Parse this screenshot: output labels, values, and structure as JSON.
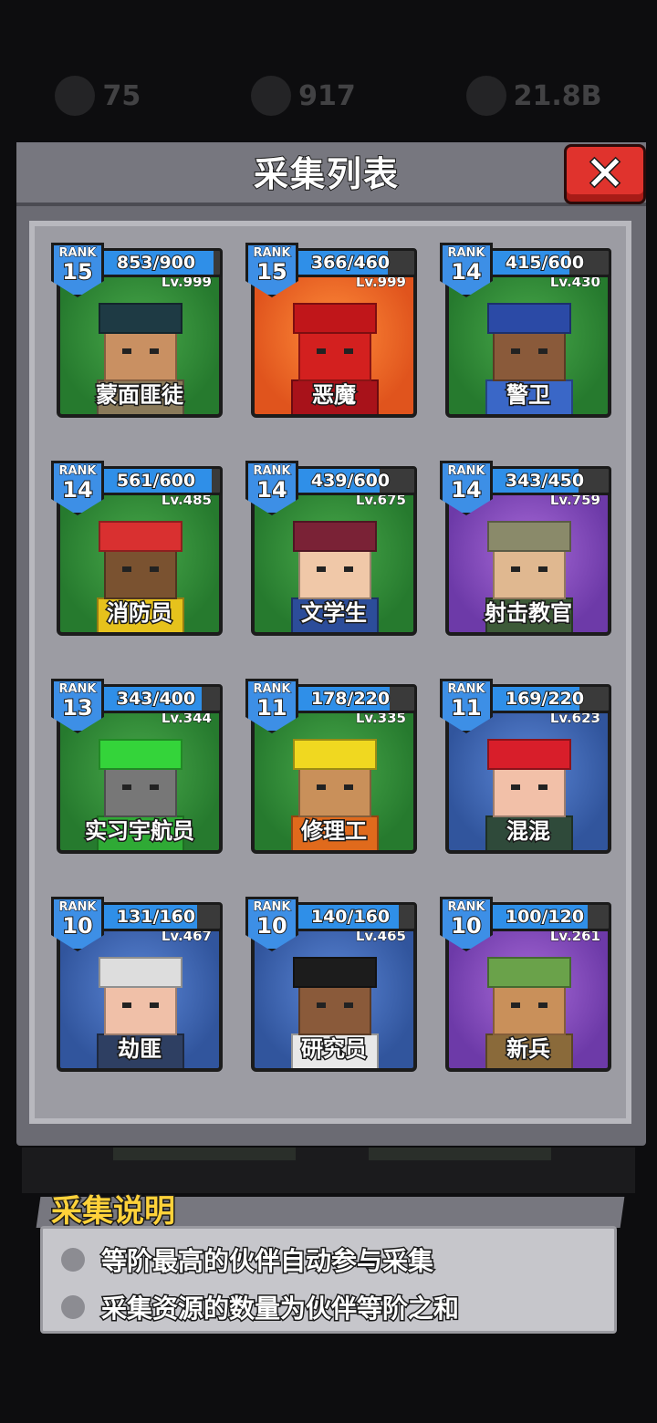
{
  "top_resources": [
    {
      "icon": "resource-icon",
      "value": "75"
    },
    {
      "icon": "resource-icon",
      "value": "917"
    },
    {
      "icon": "resource-icon",
      "value": "21.8B"
    }
  ],
  "dialog": {
    "title": "采集列表",
    "close_label": "✕"
  },
  "rank_label": "RANK",
  "companions": [
    {
      "rank": "15",
      "progress": "853/900",
      "progress_fraction": 0.948,
      "level": "Lv.999",
      "name": "蒙面匪徒",
      "bg": "green",
      "hat": "#1e3a44",
      "skin": "#c99062",
      "outfit": "#8a7a5a"
    },
    {
      "rank": "15",
      "progress": "366/460",
      "progress_fraction": 0.796,
      "level": "Lv.999",
      "name": "恶魔",
      "bg": "orange",
      "hat": "#c0161a",
      "skin": "#d3201f",
      "outfit": "#a8121a"
    },
    {
      "rank": "14",
      "progress": "415/600",
      "progress_fraction": 0.692,
      "level": "Lv.430",
      "name": "警卫",
      "bg": "green",
      "hat": "#2b4aa6",
      "skin": "#8a5a3a",
      "outfit": "#3a67c7"
    },
    {
      "rank": "14",
      "progress": "561/600",
      "progress_fraction": 0.935,
      "level": "Lv.485",
      "name": "消防员",
      "bg": "green",
      "hat": "#d93030",
      "skin": "#7a5230",
      "outfit": "#e6c21c"
    },
    {
      "rank": "14",
      "progress": "439/600",
      "progress_fraction": 0.732,
      "level": "Lv.675",
      "name": "文学生",
      "bg": "green",
      "hat": "#7a2236",
      "skin": "#f0c8a8",
      "outfit": "#2c4d9a"
    },
    {
      "rank": "14",
      "progress": "343/450",
      "progress_fraction": 0.762,
      "level": "Lv.759",
      "name": "射击教官",
      "bg": "purple",
      "hat": "#8a8a6a",
      "skin": "#e0b890",
      "outfit": "#3d5a38"
    },
    {
      "rank": "13",
      "progress": "343/400",
      "progress_fraction": 0.858,
      "level": "Lv.344",
      "name": "实习宇航员",
      "bg": "green",
      "hat": "#34d43a",
      "skin": "#777777",
      "outfit": "#2faa35"
    },
    {
      "rank": "11",
      "progress": "178/220",
      "progress_fraction": 0.809,
      "level": "Lv.335",
      "name": "修理工",
      "bg": "green",
      "hat": "#f0d820",
      "skin": "#c9905a",
      "outfit": "#e06a1c"
    },
    {
      "rank": "11",
      "progress": "169/220",
      "progress_fraction": 0.768,
      "level": "Lv.623",
      "name": "混混",
      "bg": "blue",
      "hat": "#d81e2a",
      "skin": "#f2c0a8",
      "outfit": "#2f4a3a"
    },
    {
      "rank": "10",
      "progress": "131/160",
      "progress_fraction": 0.819,
      "level": "Lv.467",
      "name": "劫匪",
      "bg": "blue",
      "hat": "#dddddd",
      "skin": "#f0c0a8",
      "outfit": "#2e3f62"
    },
    {
      "rank": "10",
      "progress": "140/160",
      "progress_fraction": 0.875,
      "level": "Lv.465",
      "name": "研究员",
      "bg": "blue",
      "hat": "#1c1c1c",
      "skin": "#8a5a3a",
      "outfit": "#e8e8e8"
    },
    {
      "rank": "10",
      "progress": "100/120",
      "progress_fraction": 0.833,
      "level": "Lv.261",
      "name": "新兵",
      "bg": "purple",
      "hat": "#6aa24a",
      "skin": "#c9905a",
      "outfit": "#8a6a3a"
    }
  ],
  "info": {
    "title": "采集说明",
    "lines": [
      "等阶最高的伙伴自动参与采集",
      "采集资源的数量为伙伴等阶之和"
    ]
  }
}
